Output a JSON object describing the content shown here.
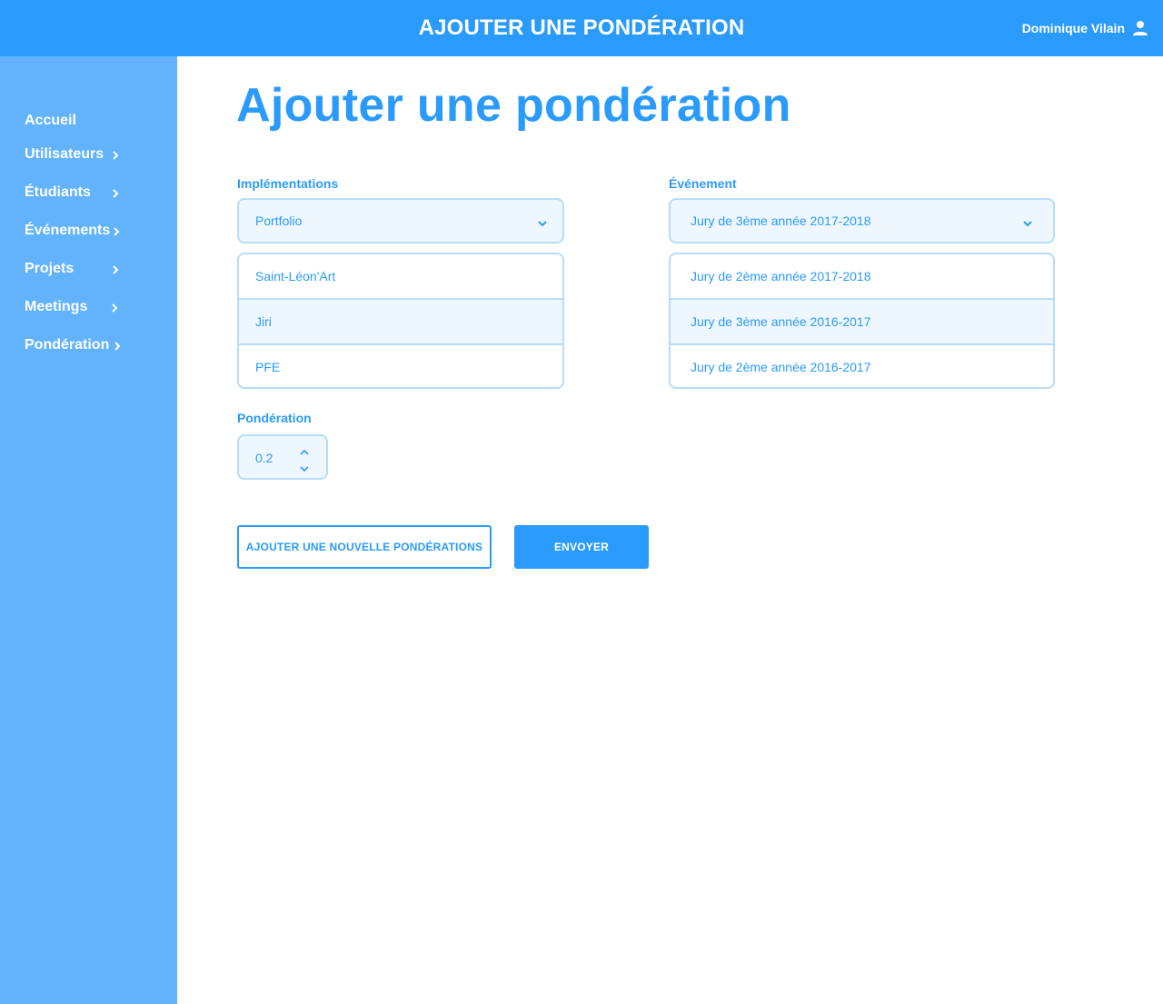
{
  "header": {
    "title": "AJOUTER UNE PONDÉRATION",
    "user_name": "Dominique Vilain",
    "user_icon": "user-icon"
  },
  "sidebar": {
    "items": [
      {
        "label": "Accueil",
        "has_chevron": false
      },
      {
        "label": "Utilisateurs",
        "has_chevron": true
      },
      {
        "label": "Étudiants",
        "has_chevron": true
      },
      {
        "label": "Événements",
        "has_chevron": true
      },
      {
        "label": "Projets",
        "has_chevron": true
      },
      {
        "label": "Meetings",
        "has_chevron": true
      },
      {
        "label": "Pondération",
        "has_chevron": true
      }
    ]
  },
  "main": {
    "title": "Ajouter une pondération",
    "implementations": {
      "label": "Implémentations",
      "selected": "Portfolio",
      "options": [
        "Saint-Léon'Art",
        "Jiri",
        "PFE"
      ]
    },
    "evenement": {
      "label": "Événement",
      "selected": "Jury de 3ème année 2017-2018",
      "options": [
        "Jury de 2ème année 2017-2018",
        "Jury de 3ème année 2016-2017",
        "Jury de 2ème année 2016-2017"
      ]
    },
    "ponderation": {
      "label": "Pondération",
      "value": "0.2"
    },
    "buttons": {
      "add_new": "AJOUTER UNE NOUVELLE PONDÉRATIONS",
      "submit": "ENVOYER"
    }
  },
  "colors": {
    "topbar": "#2a9bfa",
    "sidebar": "#62b3fc",
    "accent": "#2a9bfa",
    "field_border": "#b9dcf7",
    "field_bg": "#eef7fe"
  }
}
